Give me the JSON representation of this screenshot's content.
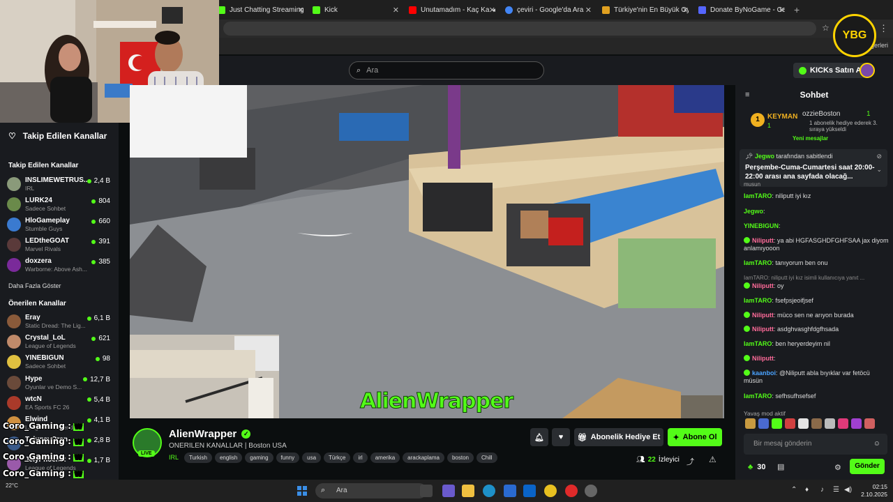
{
  "browser": {
    "tabs": [
      {
        "label": "Just Chatting Streaming -",
        "color": "#53fc18",
        "speaker": false
      },
      {
        "label": "Kick",
        "color": "#53fc18",
        "speaker": false
      },
      {
        "label": "Unutamadım - Kaç Ka",
        "color": "#ff0000",
        "speaker": true
      },
      {
        "label": "çeviri - Google'da Ara",
        "color": "#4285f4",
        "speaker": false
      },
      {
        "label": "Türkiye'nin En Büyük Oyu",
        "color": "#e0a020",
        "speaker": false
      },
      {
        "label": "Donate ByNoGame - Geli",
        "color": "#5566ff",
        "speaker": false
      }
    ],
    "bookmark_label": "ğerleri"
  },
  "header": {
    "search_placeholder": "Ara",
    "kicks_label": "KICKs Satın Al"
  },
  "sidebar": {
    "title": "Takip Edilen Kanallar",
    "followed_title": "Takip Edilen Kanallar",
    "followed": [
      {
        "name": "INSLIMEWETRUS...",
        "sub": "IRL",
        "count": "2,4 B",
        "color": "#8a9a7a"
      },
      {
        "name": "LURK24",
        "sub": "Sadece Sohbet",
        "count": "804",
        "color": "#6a8a4a"
      },
      {
        "name": "HloGameplay",
        "sub": "Stumble Guys",
        "count": "660",
        "color": "#3a7ad0"
      },
      {
        "name": "LEDtheGOAT",
        "sub": "Marvel Rivals",
        "count": "391",
        "color": "#5a3a3a"
      },
      {
        "name": "doxzera",
        "sub": "Warborne: Above Ash...",
        "count": "385",
        "color": "#7a2a9a"
      }
    ],
    "show_more": "Daha Fazla Göster",
    "recommended_title": "Önerilen Kanallar",
    "recommended": [
      {
        "name": "Eray",
        "sub": "Static Dread: The Lig...",
        "count": "6,1 B",
        "color": "#8a5a3a"
      },
      {
        "name": "Crystal_LoL",
        "sub": "League of Legends",
        "count": "621",
        "color": "#c08a6a"
      },
      {
        "name": "YINEBIGUN",
        "sub": "Sadece Sohbet",
        "count": "98",
        "color": "#e0c040"
      },
      {
        "name": "Hype",
        "sub": "Oyunlar ve Demo S...",
        "count": "12,7 B",
        "color": "#6a4a3a"
      },
      {
        "name": "wtcN",
        "sub": "EA Sports FC 26",
        "count": "5,4 B",
        "color": "#aa3a2a"
      },
      {
        "name": "Elwind",
        "sub": "League of Legends",
        "count": "4,1 B",
        "color": "#d09040"
      },
      {
        "name": "TolunayOren",
        "sub": "",
        "count": "2,8 B",
        "color": "#3a5a8a"
      },
      {
        "name": "JelyPhoenix",
        "sub": "League of Legends",
        "count": "1,7 B",
        "color": "#9a5aaa"
      }
    ]
  },
  "coro_overlay": [
    "Coro_Gaming :",
    "Coro_Gaming :",
    "Coro_Gaming :",
    "Coro_Gaming :",
    "Coro_Gaming :"
  ],
  "coro_badge": "W",
  "video": {
    "overlay_text": "AlienWrapper"
  },
  "stream": {
    "channel": "AlienWrapper",
    "live_label": "LIVE",
    "subtitle": "ONERILEN KANALLAR | Boston USA",
    "category": "IRL",
    "tags": [
      "Turkish",
      "english",
      "gaming",
      "funny",
      "usa",
      "Türkçe",
      "irl",
      "amerika",
      "arackaplama",
      "boston",
      "Chill"
    ],
    "gift_sub_label": "Abonelik Hediye Et",
    "subscribe_label": "Abone Ol",
    "viewer_count": "22",
    "viewer_label": "İzleyici"
  },
  "chat": {
    "title": "Sohbet",
    "gifter_top": "KEYMAN",
    "gifter_top_count": "1",
    "gifter_second": "ozzieBoston",
    "gifter_second_count": "1",
    "gifter_note": "1 abonelik hediye ederek 3. sıraya yükseldi",
    "new_messages": "Yeni mesajlar",
    "pinned_by": "Jegwo",
    "pinned_suffix": "tarafından sabitlendi",
    "pinned_text": "Perşembe-Cuma-Cumartesi saat 20:00-22:00 arası ana sayfada olacağ...",
    "partial_line": "musun",
    "messages": [
      {
        "user": "IamTARO",
        "text": "niliputt iyi kız",
        "color": "#53fc18",
        "badge": false
      },
      {
        "user": "Jegwo",
        "text": "",
        "color": "#53fc18",
        "badge": false
      },
      {
        "user": "YINEBIGUN",
        "text": "",
        "color": "#53fc18",
        "badge": false
      },
      {
        "user": "Niliputt",
        "text": "ya abi HGFASGHDFGHFSAA jax diyom anlamıyooon",
        "color": "#ff6b9a",
        "badge": true
      },
      {
        "user": "IamTARO",
        "text": "tanıyorum ben onu",
        "color": "#53fc18",
        "badge": false
      },
      {
        "user": "reply",
        "text": "IamTARO: niliputt iyi kız isimli kullanıcıya yanıt ...",
        "color": "#8a8a8a",
        "badge": false
      },
      {
        "user": "Niliputt",
        "text": "oy",
        "color": "#ff6b9a",
        "badge": true
      },
      {
        "user": "IamTARO",
        "text": "fsefpsjeoifjsef",
        "color": "#53fc18",
        "badge": false
      },
      {
        "user": "Niliputt",
        "text": "müco sen ne arıyon burada",
        "color": "#ff6b9a",
        "badge": true
      },
      {
        "user": "Niliputt",
        "text": "asdghvasghfdgfhsada",
        "color": "#ff6b9a",
        "badge": true
      },
      {
        "user": "IamTARO",
        "text": "ben heryerdeyim nil",
        "color": "#53fc18",
        "badge": false
      },
      {
        "user": "Niliputt",
        "text": "",
        "color": "#ff6b9a",
        "badge": true
      },
      {
        "user": "kaanboi",
        "text": "@Niliputt abla bıyıklar var fetöcü müsün",
        "color": "#4aa3ff",
        "badge": true
      },
      {
        "user": "IamTARO",
        "text": "sefhsufhsefsef",
        "color": "#53fc18",
        "badge": false
      }
    ],
    "slow_mode": "Yavaş mod aktif",
    "input_placeholder": "Bir mesaj gönderin",
    "points": "30",
    "send_label": "Gönder"
  },
  "taskbar": {
    "search_label": "Ara",
    "time": "02:15",
    "date": "2.10.2025",
    "weather": "22°C"
  },
  "logo_text": "YBG"
}
